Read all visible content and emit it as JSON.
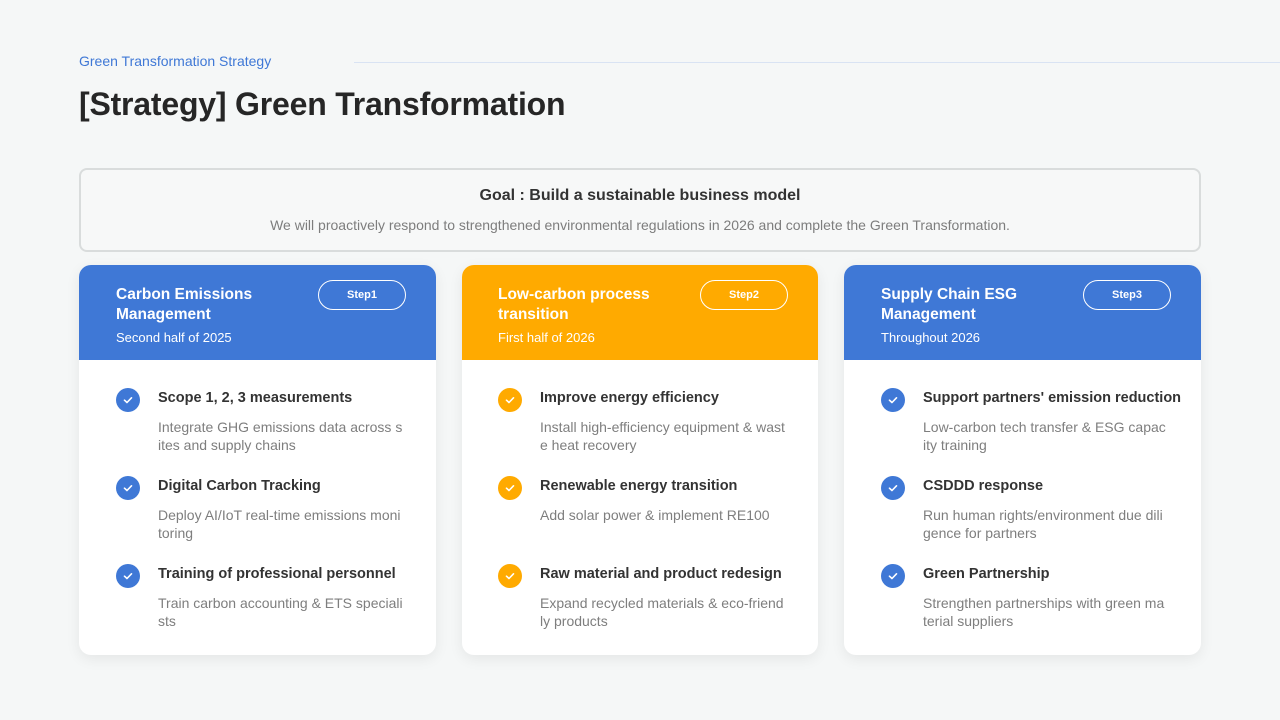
{
  "header": {
    "eyebrow": "Green Transformation Strategy",
    "title": "[Strategy] Green Transformation"
  },
  "goal": {
    "title": "Goal : Build a sustainable business model",
    "description": "We will proactively respond to strengthened environmental regulations in 2026 and complete the Green Transformation."
  },
  "colors": {
    "blue": "#3f78d6",
    "orange": "#ffaa00"
  },
  "cards": [
    {
      "title": "Carbon Emissions Management",
      "period": "Second half of 2025",
      "step": "Step1",
      "items": [
        {
          "title": "Scope 1, 2, 3 measurements",
          "desc": "Integrate GHG emissions data across sites and supply chains"
        },
        {
          "title": "Digital Carbon Tracking",
          "desc": "Deploy AI/IoT real-time emissions monitoring"
        },
        {
          "title": "Training of professional personnel",
          "desc": "Train carbon accounting & ETS specialists"
        }
      ]
    },
    {
      "title": "Low-carbon process transition",
      "period": "First half of 2026",
      "step": "Step2",
      "items": [
        {
          "title": "Improve energy efficiency",
          "desc": "Install high-efficiency equipment & waste heat recovery"
        },
        {
          "title": "Renewable energy transition",
          "desc": "Add solar power & implement RE100"
        },
        {
          "title": "Raw material and product redesign",
          "desc": "Expand recycled materials & eco-friendly products"
        }
      ]
    },
    {
      "title": "Supply Chain ESG Management",
      "period": "Throughout 2026",
      "step": "Step3",
      "items": [
        {
          "title": "Support partners' emission reduction",
          "desc": "Low-carbon tech transfer & ESG capacity training"
        },
        {
          "title": "CSDDD response",
          "desc": "Run human rights/environment due diligence for partners"
        },
        {
          "title": "Green Partnership",
          "desc": "Strengthen partnerships with green material suppliers"
        }
      ]
    }
  ]
}
